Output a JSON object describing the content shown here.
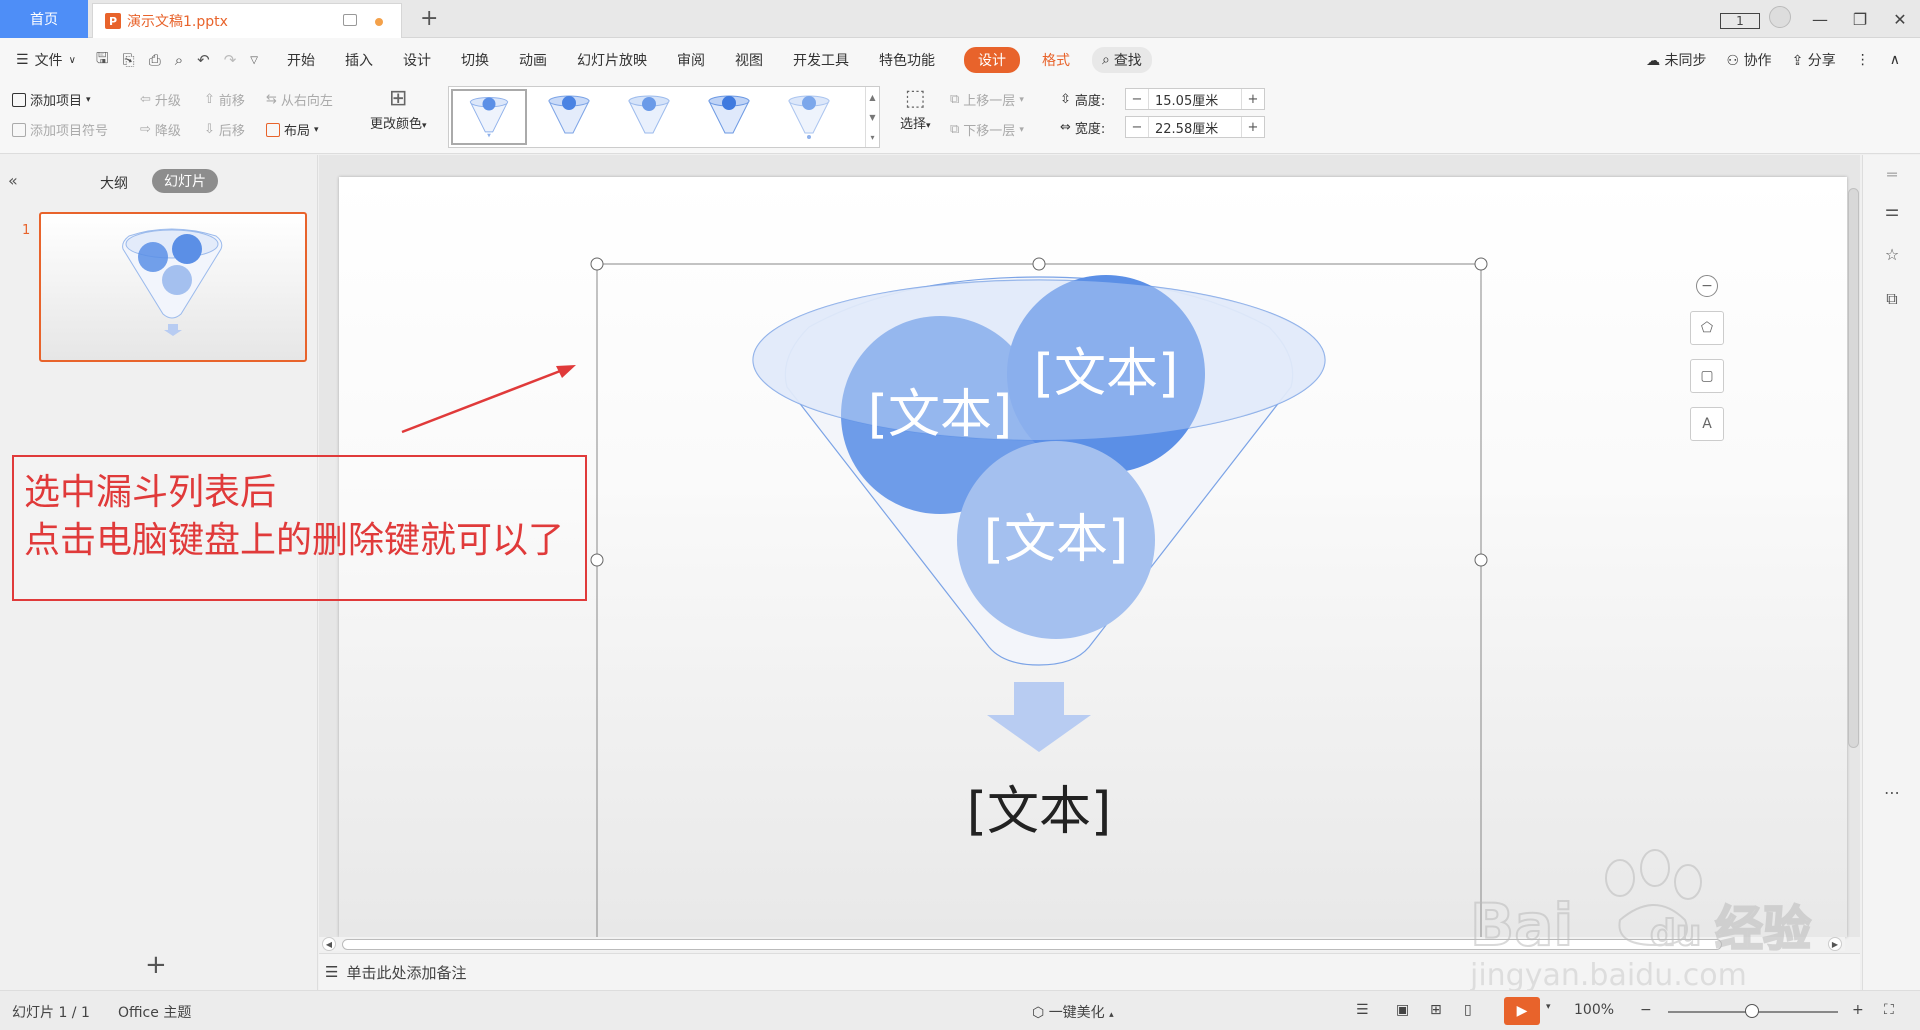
{
  "titlebar": {
    "home_tab": "首页",
    "doc_tab": "演示文稿1.pptx",
    "ppt_glyph": "P",
    "page_indicator": "1"
  },
  "menubar": {
    "file": "文件",
    "items": [
      "开始",
      "插入",
      "设计",
      "切换",
      "动画",
      "幻灯片放映",
      "审阅",
      "视图",
      "开发工具",
      "特色功能"
    ],
    "design_active": "设计",
    "format": "格式",
    "search": "查找",
    "sync": "未同步",
    "collab": "协作",
    "share": "分享"
  },
  "ribbon": {
    "add_item": "添加项目",
    "add_bullet": "添加项目符号",
    "promote": "升级",
    "demote": "降级",
    "move_forward": "前移",
    "move_back": "后移",
    "right_to_left": "从右向左",
    "layout": "布局",
    "change_color": "更改颜色",
    "select": "选择",
    "bring_forward": "上移一层",
    "send_backward": "下移一层",
    "height_label": "高度:",
    "height_value": "15.05厘米",
    "width_label": "宽度:",
    "width_value": "22.58厘米"
  },
  "left_pane": {
    "outline_tab": "大纲",
    "slides_tab": "幻灯片",
    "slide_number": "1"
  },
  "annotation": {
    "line1": "选中漏斗列表后",
    "line2": "点击电脑键盘上的删除键就可以了"
  },
  "slide": {
    "circle_text_left": "[文本]",
    "circle_text_right": "[文本]",
    "circle_text_bottom": "[文本]",
    "bottom_text": "[文本]"
  },
  "notes": {
    "placeholder": "单击此处添加备注"
  },
  "status": {
    "slide_counter": "幻灯片 1 / 1",
    "theme": "Office 主题",
    "beautify": "一键美化",
    "zoom": "100%"
  },
  "watermark": {
    "brand": "Bai",
    "brand2": "du",
    "brand_cn": "经验",
    "url": "jingyan.baidu.com"
  },
  "colors": {
    "accent": "#e8632b",
    "home_tab": "#4e8ef7",
    "circle_dark": "#5b8fe6",
    "circle_light": "#a4c0ef",
    "annotation": "#e03a3a"
  }
}
